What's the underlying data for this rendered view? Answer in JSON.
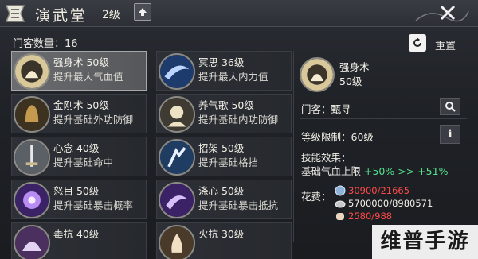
{
  "header": {
    "title": "演武堂",
    "level": "2级"
  },
  "disciple_count": "门客数量：16",
  "reset_label": "重置",
  "skills": [
    {
      "name": "强身术 50级",
      "desc": "提升最大气血值",
      "icon": "meditation-icon",
      "selected": true
    },
    {
      "name": "冥思 36级",
      "desc": "提升最大内力值",
      "icon": "swirl-icon"
    },
    {
      "name": "金刚术 50级",
      "desc": "提升基础外功防御",
      "icon": "bell-icon"
    },
    {
      "name": "养气歌 50级",
      "desc": "提升基础内功防御",
      "icon": "breath-icon"
    },
    {
      "name": "心念 40级",
      "desc": "提升基础命中",
      "icon": "sword-icon"
    },
    {
      "name": "招架 50级",
      "desc": "提升基础格挡",
      "icon": "parry-icon"
    },
    {
      "name": "怒目 50级",
      "desc": "提升基础暴击概率",
      "icon": "purple-orb-icon"
    },
    {
      "name": "涤心 50级",
      "desc": "提升基础暴击抵抗",
      "icon": "purple-swirl-icon"
    },
    {
      "name": "毒抗 40级",
      "desc": "",
      "icon": "poison-icon"
    },
    {
      "name": "火抗 30级",
      "desc": "",
      "icon": "fire-icon"
    }
  ],
  "detail": {
    "name": "强身术",
    "level": "50级",
    "disciple_label": "门客：甄寻",
    "level_limit": "等级限制：60级",
    "effect_label": "技能效果：",
    "effect_base": "基础气血上限",
    "effect_current": "+50%",
    "effect_arrow": ">>",
    "effect_next": "+51%",
    "cost_label": "花费：",
    "costs": [
      {
        "icon": "coin-icon",
        "value": "30900/21665",
        "color": "red"
      },
      {
        "icon": "silver-icon",
        "value": "5700000/8980571",
        "color": "white"
      },
      {
        "icon": "fist-icon",
        "value": "2580/988",
        "color": "red"
      }
    ]
  },
  "watermark": "维普手游网"
}
